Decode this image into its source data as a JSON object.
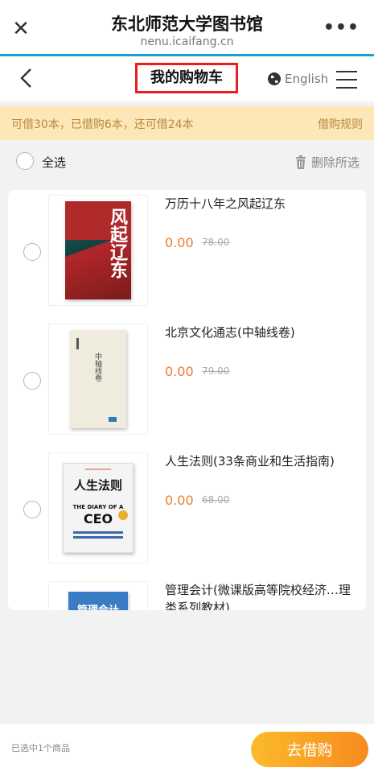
{
  "topbar": {
    "site_title": "东北师范大学图书馆",
    "site_domain": "nenu.icaifang.cn",
    "more_label": "•••"
  },
  "navbar": {
    "page_title": "我的购物车",
    "language_label": "English"
  },
  "notice": {
    "quota_text": "可借30本，已借购6本，还可借24本",
    "rules_label": "借购规则"
  },
  "selection": {
    "select_all_label": "全选",
    "delete_selected_label": "删除所选"
  },
  "items": [
    {
      "title": "万历十八年之风起辽东",
      "price": "0.00",
      "original_price": "78.00",
      "cover_text": "风起辽东"
    },
    {
      "title": "北京文化通志(中轴线卷)",
      "price": "0.00",
      "original_price": "79.00",
      "cover_text": "中轴线卷"
    },
    {
      "title": "人生法则(33条商业和生活指南)",
      "price": "0.00",
      "original_price": "68.00",
      "cover_text": "人生法则",
      "cover_subtitle": "THE DIARY OF A",
      "cover_big": "CEO"
    },
    {
      "title": "管理会计(微课版高等院校经济…理类系列教材)",
      "price": "",
      "original_price": "",
      "cover_text": "管理会计"
    }
  ],
  "footer": {
    "selected_count_text": "已选中1个商品",
    "checkout_label": "去借购"
  },
  "colors": {
    "accent_orange": "#f07a2b",
    "notice_bg": "#fde6b8",
    "highlight_border": "#ee1c1c",
    "topbar_line": "#1aa0d8"
  }
}
